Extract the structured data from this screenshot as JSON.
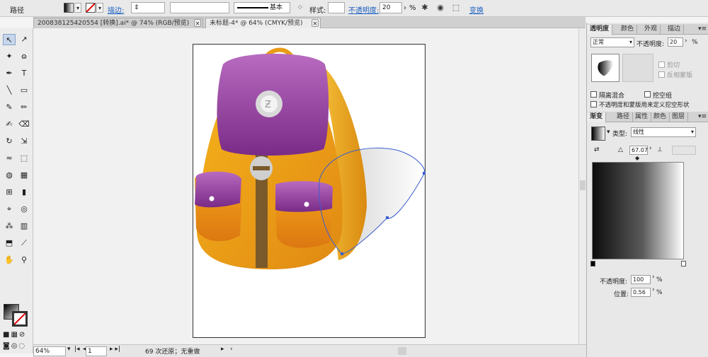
{
  "control_bar": {
    "object_type": "路径",
    "stroke_label": "描边:",
    "stroke_profile": "基本",
    "style_label": "样式:",
    "opacity_label": "不透明度:",
    "opacity_value": "20",
    "opacity_unit": "%",
    "transform_label": "变换"
  },
  "tabs": [
    {
      "label": "200838125420554 [转换].ai* @ 74% (RGB/预览)",
      "active": false
    },
    {
      "label": "未标题-4* @ 64% (CMYK/预览)",
      "active": true
    }
  ],
  "tools": [
    {
      "name": "selection-tool",
      "glyph": "↖"
    },
    {
      "name": "direct-selection-tool",
      "glyph": "↗"
    },
    {
      "name": "magic-wand-tool",
      "glyph": "✦"
    },
    {
      "name": "lasso-tool",
      "glyph": "ɷ"
    },
    {
      "name": "pen-tool",
      "glyph": "✒"
    },
    {
      "name": "type-tool",
      "glyph": "T"
    },
    {
      "name": "line-tool",
      "glyph": "╲"
    },
    {
      "name": "rectangle-tool",
      "glyph": "▭"
    },
    {
      "name": "paintbrush-tool",
      "glyph": "✎"
    },
    {
      "name": "pencil-tool",
      "glyph": "✏"
    },
    {
      "name": "blob-brush-tool",
      "glyph": "✍"
    },
    {
      "name": "eraser-tool",
      "glyph": "⌫"
    },
    {
      "name": "rotate-tool",
      "glyph": "↻"
    },
    {
      "name": "scale-tool",
      "glyph": "⇲"
    },
    {
      "name": "warp-tool",
      "glyph": "≈"
    },
    {
      "name": "free-transform-tool",
      "glyph": "⬚"
    },
    {
      "name": "shape-builder-tool",
      "glyph": "◍"
    },
    {
      "name": "perspective-grid-tool",
      "glyph": "▦"
    },
    {
      "name": "mesh-tool",
      "glyph": "⊞"
    },
    {
      "name": "gradient-tool",
      "glyph": "▮"
    },
    {
      "name": "eyedropper-tool",
      "glyph": "⌖"
    },
    {
      "name": "blend-tool",
      "glyph": "◎"
    },
    {
      "name": "symbol-sprayer-tool",
      "glyph": "⁂"
    },
    {
      "name": "column-graph-tool",
      "glyph": "▥"
    },
    {
      "name": "artboard-tool",
      "glyph": "⬒"
    },
    {
      "name": "slice-tool",
      "glyph": "⟋"
    },
    {
      "name": "hand-tool",
      "glyph": "✋"
    },
    {
      "name": "zoom-tool",
      "glyph": "⚲"
    }
  ],
  "status_bar": {
    "zoom": "64%",
    "artboard_number": "1",
    "history": "69 次还原；无重做"
  },
  "transparency_panel": {
    "tabs": [
      "透明度",
      "颜色",
      "外观",
      "描边"
    ],
    "blend_mode": "正常",
    "opacity_label": "不透明度:",
    "opacity_value": "20",
    "opacity_unit": "%",
    "clip_label": "剪切",
    "invert_mask_label": "反相蒙版",
    "isolate_blending_label": "隔离混合",
    "knockout_group_label": "挖空组",
    "opacity_mask_define_label": "不透明度和蒙版用来定义挖空形状"
  },
  "gradient_panel": {
    "tabs": [
      "渐变",
      "路径",
      "属性",
      "颜色",
      "图层"
    ],
    "type_label": "类型:",
    "type_value": "线性",
    "angle_value": "67.07",
    "opacity_label": "不透明度:",
    "opacity_value": "100",
    "opacity_unit": "%",
    "location_label": "位置:",
    "location_value": "0.56",
    "location_unit": "%"
  }
}
